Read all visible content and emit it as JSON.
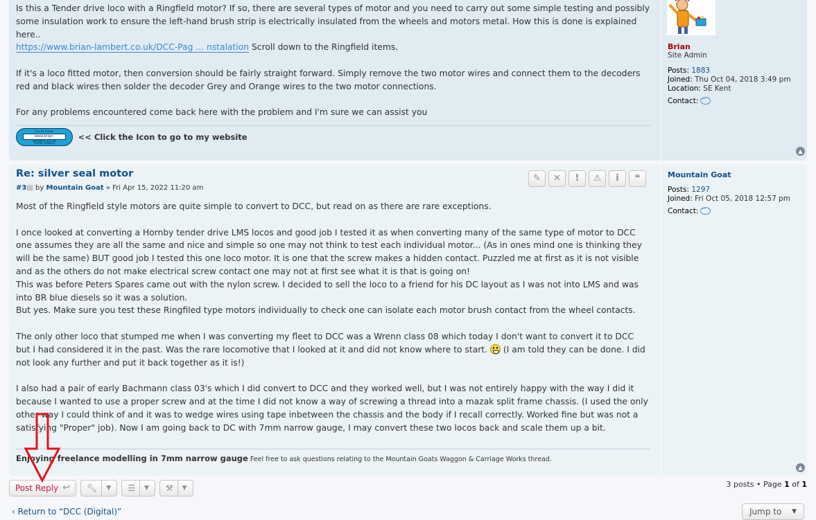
{
  "post1": {
    "paragraphs": [
      "Is this a Tender drive loco with a Ringfield motor? If so, there are several types of motor and you need to carry out some simple testing and possibly some insulation work to ensure the left-hand brush strip is electrically insulated from the wheels and motors metal. How this is done is explained here..",
      "If it's a loco fitted motor, then conversion should be fairly straight forward. Simply remove the two motor wires and connect them to the decoders red and black wires then solder the decoder Grey and Orange wires to the two motor connections.",
      "For any problems encountered come back here with the problem and I'm sure we can assist you"
    ],
    "link_text": "https://www.brian-lambert.co.uk/DCC-Pag ... nstalation",
    "link_suffix": " Scroll down to the Ringfield items.",
    "signature": {
      "badge_top": "For all things",
      "badge_url": "www.brian-lambert.co.uk",
      "badge_bottom": "model railways",
      "text": "<< Click the Icon to go to my website"
    },
    "profile": {
      "name": "Brian",
      "rank": "Site Admin",
      "posts_label": "Posts:",
      "posts": "1883",
      "joined_label": "Joined:",
      "joined": "Thu Oct 04, 2018 3:49 pm",
      "location_label": "Location:",
      "location": "SE Kent",
      "contact_label": "Contact:"
    }
  },
  "post2": {
    "title": "Re: silver seal motor",
    "number": "#3",
    "by": "by",
    "author": "Mountain Goat",
    "date": "» Fri Apr 15, 2022 11:20 am",
    "tools": [
      "✎",
      "✕",
      "!",
      "⚠",
      "i",
      "❝"
    ],
    "p1": "Most of the Ringfield style motors are quite simple to convert to DCC, but read on as there are rare exceptions.",
    "p2_lines": [
      "I once looked at converting a Hornby tender drive LMS locos and good job I tested it as when converting many of the same type of motor to DCC one assumes they are all the same and nice and simple so one may not think to test each individual motor... (As in ones mind one is thinking they will be the same) BUT good job I tested this one loco motor. It is one that the screw makes a hidden contact. Puzzled me at first as it is not visible and as the others do not make electrical screw contact one may not at first see what it is that is going on!",
      "This was before Peters Spares came out with the nylon screw. I decided to sell the loco to a friend for his DC layout as I was not into LMS and was into BR blue diesels so it was a solution.",
      "But yes. Make sure you test these Ringfiled type motors individually to check one can isolate each motor brush contact from the wheel contacts."
    ],
    "p3a": "The only other loco that stumped me when I was converting my fleet to DCC was a Wrenn class 08 which today I don't want to convert it to DCC but I had considered it in the past. Was the rare locomotive that I looked at it and did not know where to start.",
    "p3b": " (I am told they can be done. I did not look any further and put it back together as it is!)",
    "p4": "I also had a pair of early Bachmann class 03's which I did convert to DCC and they worked well, but I was not entirely happy with the way I did it because I wanted to use a proper screw and at the time I did not know a way of screwing a thread into a mazak split frame chassis. (I used the only other way I could think of and it was to wedge wires using tape inbetween the chassis and the body if I recall correctly. Worked fine but was not a satisfying \"Proper\" job). Now I am going back to DC with 7mm narrow gauge, I may convert these two locos back and scale them up a bit.",
    "sig_bold": "Enjoying freelance modelling in 7mm narrow gauge",
    "sig_rest": " Feel free to ask questions relating to the Mountain Goats Waggon & Carriage Works thread.",
    "profile": {
      "name": "Mountain Goat",
      "posts_label": "Posts:",
      "posts": "1297",
      "joined_label": "Joined:",
      "joined": "Fri Oct 05, 2018 12:57 pm",
      "contact_label": "Contact:"
    }
  },
  "actions": {
    "post_reply": "Post Reply",
    "pagination_pre": "3 posts • Page ",
    "page_current": "1",
    "pagination_of": " of ",
    "page_total": "1",
    "return_link": "‹  Return to “DCC (Digital)”",
    "jump_to": "Jump to"
  },
  "colors": {
    "annotation_arrow": "#e3141b",
    "post_bg_1": "#e1ebf2",
    "post_bg_2": "#ecf3f7",
    "link": "#105289"
  }
}
